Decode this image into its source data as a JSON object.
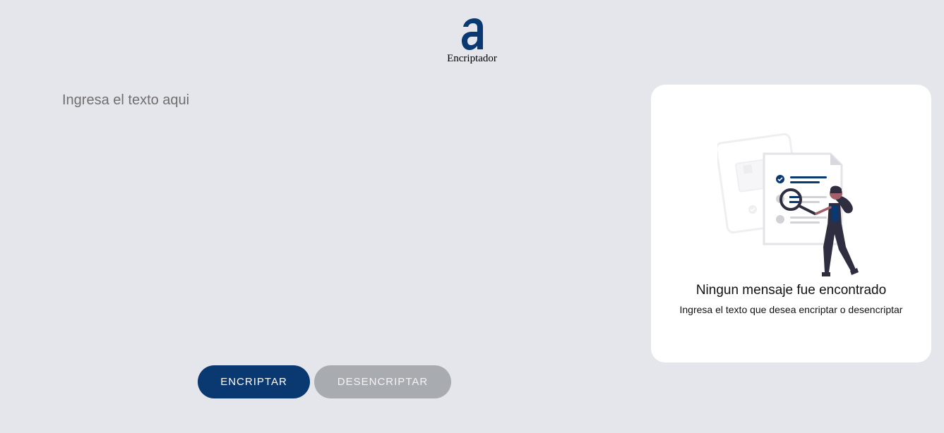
{
  "header": {
    "logo_icon": "alura-a-logo",
    "title": "Encriptador"
  },
  "input": {
    "placeholder": "Ingresa el texto aqui",
    "value": ""
  },
  "buttons": {
    "encrypt_label": "ENCRIPTAR",
    "decrypt_label": "DESENCRIPTAR"
  },
  "result_panel": {
    "illustration_icon": "person-searching-document-illustration",
    "title": "Ningun mensaje fue encontrado",
    "subtitle": "Ingresa el texto que desea encriptar o desencriptar"
  },
  "colors": {
    "background": "#e5e6ec",
    "primary": "#0a3871",
    "secondary_button": "#a8abb0",
    "panel": "#ffffff"
  }
}
